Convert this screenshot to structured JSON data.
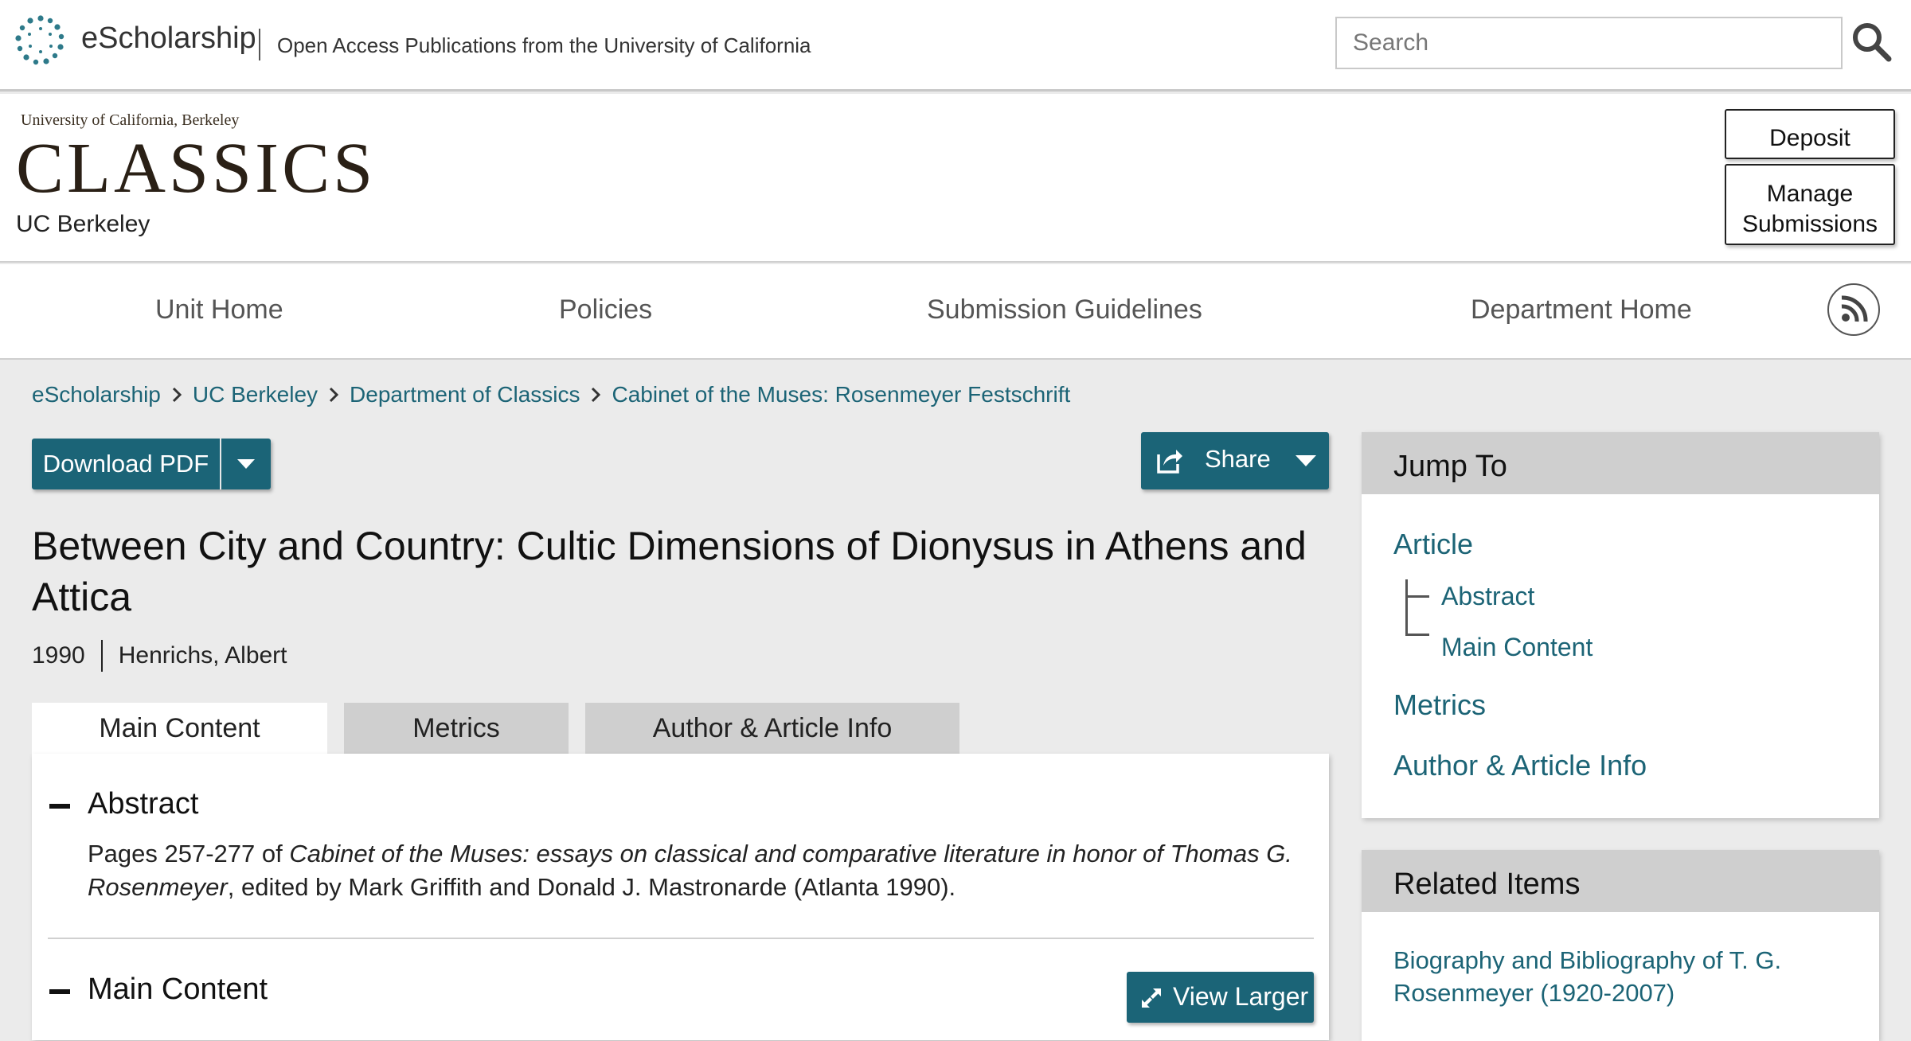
{
  "site": {
    "brand": "eScholarship",
    "tagline": "Open Access Publications from the University of California",
    "search_placeholder": "Search"
  },
  "unit": {
    "logo_small": "University of California, Berkeley",
    "logo_big": "CLASSICS",
    "name": "UC Berkeley",
    "deposit_label": "Deposit",
    "manage_label_line1": "Manage",
    "manage_label_line2": "Submissions"
  },
  "nav": {
    "items": [
      "Unit Home",
      "Policies",
      "Submission Guidelines",
      "Department Home"
    ]
  },
  "breadcrumb": [
    "eScholarship",
    "UC Berkeley",
    "Department of Classics",
    "Cabinet of the Muses: Rosenmeyer Festschrift"
  ],
  "actions": {
    "download_label": "Download PDF",
    "share_label": "Share"
  },
  "article": {
    "title": "Between City and Country: Cultic Dimensions of Dionysus in Athens and Attica",
    "year": "1990",
    "author": "Henrichs, Albert"
  },
  "tabs": [
    "Main Content",
    "Metrics",
    "Author & Article Info"
  ],
  "abstract": {
    "heading": "Abstract",
    "text_before": "Pages 257-277 of ",
    "text_italic": "Cabinet of the Muses: essays on classical and comparative literature in honor of Thomas G. Rosenmeyer",
    "text_after": ", edited by Mark Griffith and Donald J. Mastronarde (Atlanta 1990)."
  },
  "main_content": {
    "heading": "Main Content",
    "view_larger_label": "View Larger"
  },
  "jump_to": {
    "heading": "Jump To",
    "article": "Article",
    "abstract": "Abstract",
    "main_content": "Main Content",
    "metrics": "Metrics",
    "author_info": "Author & Article Info"
  },
  "related": {
    "heading": "Related Items",
    "item1": "Biography and Bibliography of T. G. Rosenmeyer (1920-2007)"
  },
  "colors": {
    "accent": "#1b6477",
    "link": "#1c6476",
    "logo_dots": "#2e7a8a"
  }
}
